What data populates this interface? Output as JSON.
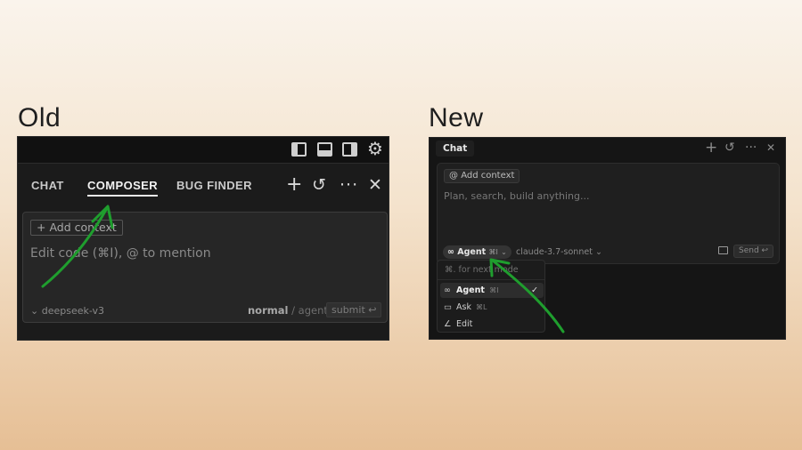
{
  "headings": {
    "old": "Old",
    "new": "New"
  },
  "old_panel": {
    "layout_icons": [
      "panel-left-icon",
      "panel-bottom-icon",
      "panel-right-icon",
      "gear-icon"
    ],
    "tabs": [
      {
        "label": "CHAT",
        "active": false
      },
      {
        "label": "COMPOSER",
        "active": true
      },
      {
        "label": "BUG FINDER",
        "active": false
      }
    ],
    "actions": [
      "plus-icon",
      "history-icon",
      "more-icon",
      "close-icon"
    ],
    "add_context": "Add context",
    "placeholder": "Edit code (⌘I), @ to mention",
    "model": "deepseek-v3",
    "mode_normal": "normal",
    "mode_sep": "/",
    "mode_agent": "agent",
    "submit": "submit ↩"
  },
  "new_panel": {
    "tab": "Chat",
    "actions": [
      "plus-icon",
      "history-icon",
      "more-icon",
      "close-icon"
    ],
    "add_context": "Add context",
    "placeholder": "Plan, search, build anything...",
    "agent_label": "Agent",
    "agent_shortcut": "⌘I",
    "model": "claude-3.7-sonnet",
    "send": "Send ↩",
    "dropdown": {
      "search_hint": "⌘. for next mode",
      "items": [
        {
          "label": "Agent",
          "shortcut": "⌘I",
          "icon": "infinity-icon",
          "selected": true
        },
        {
          "label": "Ask",
          "shortcut": "⌘L",
          "icon": "chat-bubble-icon",
          "selected": false
        },
        {
          "label": "Edit",
          "shortcut": "",
          "icon": "pencil-icon",
          "selected": false
        }
      ]
    }
  },
  "colors": {
    "arrow": "#1f9e2e",
    "panel_bg": "#1b1b1b"
  }
}
